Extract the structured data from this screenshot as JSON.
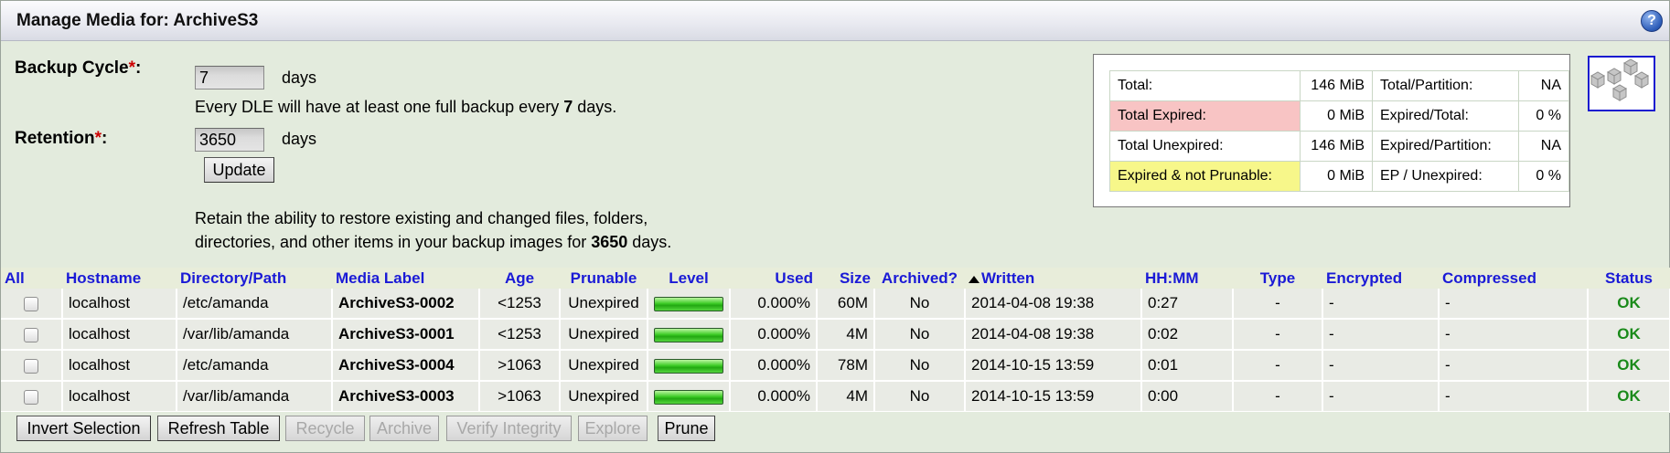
{
  "title": "Manage Media for: ArchiveS3",
  "help_icon": "?",
  "form": {
    "backup_cycle_label": "Backup Cycle",
    "retention_label": "Retention",
    "required_mark": "*",
    "colon": ":",
    "backup_cycle_value": "7",
    "retention_value": "3650",
    "days_unit": "days",
    "cycle_note_prefix": "Every DLE will have at least one full backup every",
    "cycle_note_value": "7",
    "cycle_note_suffix": "days.",
    "update_label": "Update",
    "retain_line1": "Retain the ability to restore existing and changed files, folders,",
    "retain_line2_prefix": "directories, and other items in your backup images for",
    "retain_value": "3650",
    "retain_suffix": "days."
  },
  "stats": {
    "total_label": "Total:",
    "total_value": "146 MiB",
    "total_partition_label": "Total/Partition:",
    "total_partition_value": "NA",
    "expired_label": "Total Expired:",
    "expired_value": "0 MiB",
    "expired_total_label": "Expired/Total:",
    "expired_total_value": "0 %",
    "unexpired_label": "Total Unexpired:",
    "unexpired_value": "146 MiB",
    "expired_partition_label": "Expired/Partition:",
    "expired_partition_value": "NA",
    "notprunable_label": "Expired & not Prunable:",
    "notprunable_value": "0 MiB",
    "ep_unexpired_label": "EP / Unexpired:",
    "ep_unexpired_value": "0 %"
  },
  "columns": {
    "all": "All",
    "hostname": "Hostname",
    "path": "Directory/Path",
    "media": "Media Label",
    "age": "Age",
    "prunable": "Prunable",
    "level": "Level",
    "used": "Used",
    "size": "Size",
    "archived": "Archived?",
    "written": "Written",
    "hhmm": "HH:MM",
    "type": "Type",
    "encrypted": "Encrypted",
    "compressed": "Compressed",
    "status": "Status"
  },
  "rows": [
    {
      "hostname": "localhost",
      "path": "/etc/amanda",
      "media": "ArchiveS3-0002",
      "age": "<1253",
      "prunable": "Unexpired",
      "level_fill": 1.0,
      "used": "0.000%",
      "size": "60M",
      "archived": "No",
      "written": "2014-04-08 19:38",
      "hhmm": "0:27",
      "type": "-",
      "encrypted": "-",
      "compressed": "-",
      "status": "OK"
    },
    {
      "hostname": "localhost",
      "path": "/var/lib/amanda",
      "media": "ArchiveS3-0001",
      "age": "<1253",
      "prunable": "Unexpired",
      "level_fill": 1.0,
      "used": "0.000%",
      "size": "4M",
      "archived": "No",
      "written": "2014-04-08 19:38",
      "hhmm": "0:02",
      "type": "-",
      "encrypted": "-",
      "compressed": "-",
      "status": "OK"
    },
    {
      "hostname": "localhost",
      "path": "/etc/amanda",
      "media": "ArchiveS3-0004",
      "age": ">1063",
      "prunable": "Unexpired",
      "level_fill": 1.0,
      "used": "0.000%",
      "size": "78M",
      "archived": "No",
      "written": "2014-10-15 13:59",
      "hhmm": "0:01",
      "type": "-",
      "encrypted": "-",
      "compressed": "-",
      "status": "OK"
    },
    {
      "hostname": "localhost",
      "path": "/var/lib/amanda",
      "media": "ArchiveS3-0003",
      "age": ">1063",
      "prunable": "Unexpired",
      "level_fill": 1.0,
      "used": "0.000%",
      "size": "4M",
      "archived": "No",
      "written": "2014-10-15 13:59",
      "hhmm": "0:00",
      "type": "-",
      "encrypted": "-",
      "compressed": "-",
      "status": "OK"
    }
  ],
  "actions": {
    "invert": "Invert Selection",
    "refresh": "Refresh Table",
    "recycle": "Recycle",
    "archive": "Archive",
    "verify": "Verify Integrity",
    "explore": "Explore",
    "prune": "Prune"
  },
  "colors": {
    "expired_bg": "#f8c4c4",
    "notprunable_bg": "#f7f78a",
    "ok": "#1a8a1a",
    "header_link": "#1a1ad6"
  }
}
